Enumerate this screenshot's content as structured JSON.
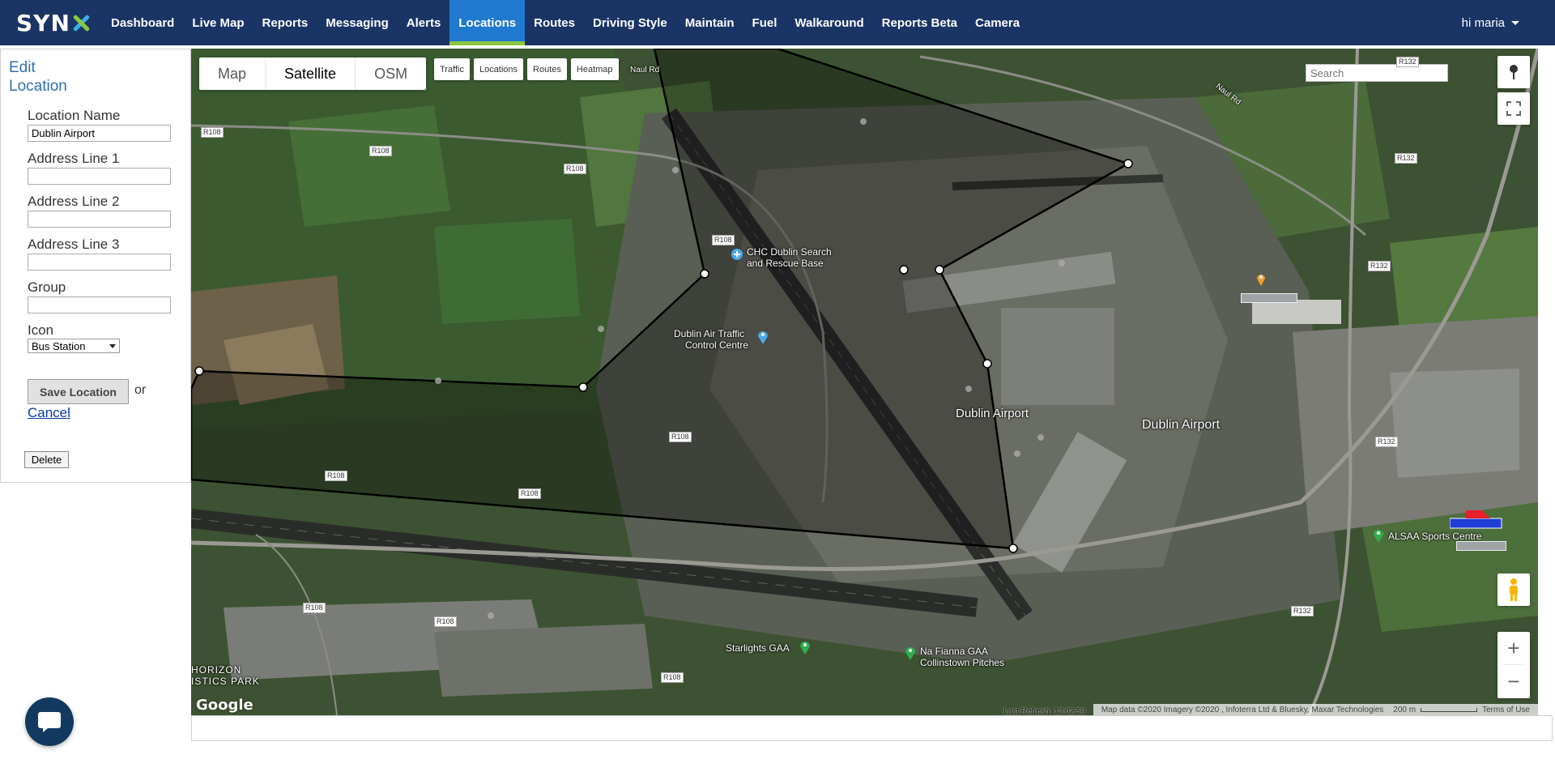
{
  "brand": {
    "logo_text": "SYN"
  },
  "nav": {
    "items": [
      {
        "label": "Dashboard"
      },
      {
        "label": "Live Map"
      },
      {
        "label": "Reports"
      },
      {
        "label": "Messaging"
      },
      {
        "label": "Alerts"
      },
      {
        "label": "Locations"
      },
      {
        "label": "Routes"
      },
      {
        "label": "Driving Style"
      },
      {
        "label": "Maintain"
      },
      {
        "label": "Fuel"
      },
      {
        "label": "Walkaround"
      },
      {
        "label": "Reports Beta"
      },
      {
        "label": "Camera"
      }
    ],
    "active": "Locations",
    "user_greeting": "hi maria"
  },
  "edit_panel": {
    "title_line1": "Edit",
    "title_line2": "Location",
    "location_name_label": "Location Name",
    "location_name_value": "Dublin Airport",
    "address1_label": "Address Line 1",
    "address1_value": "",
    "address2_label": "Address Line 2",
    "address2_value": "",
    "address3_label": "Address Line 3",
    "address3_value": "",
    "group_label": "Group",
    "group_value": "",
    "icon_label": "Icon",
    "icon_value": "Bus Station",
    "save_label": "Save Location",
    "or_text": "or",
    "cancel_label": "Cancel",
    "delete_label": "Delete"
  },
  "map": {
    "map_types": [
      "Map",
      "Satellite",
      "OSM"
    ],
    "active_map_type": "Satellite",
    "layer_buttons": [
      "Traffic",
      "Locations",
      "Routes",
      "Heatmap"
    ],
    "search_placeholder": "Search",
    "zoom_in": "+",
    "zoom_out": "−",
    "google_logo": "Google",
    "last_refresh": "Last Refresh: 13:02:59",
    "attribution": "Map data ©2020 Imagery ©2020 , Infoterra Ltd & Bluesky, Maxar Technologies",
    "scale": "200 m",
    "terms": "Terms of Use",
    "labels": {
      "chc": "CHC Dublin Search and Rescue Base",
      "chc_line1": "CHC Dublin Search",
      "chc_line2": "and Rescue Base",
      "atc_line1": "Dublin Air Traffic",
      "atc_line2": "Control Centre",
      "airport_1": "Dublin Airport",
      "airport_2": "Dublin Airport",
      "alsaa": "ALSAA Sports Centre",
      "starlights": "Starlights GAA",
      "nafianna_line1": "Na Fianna GAA",
      "nafianna_line2": "Collinstown Pitches",
      "horizon_line1": "HORIZON",
      "horizon_line2": "ISTICS PARK",
      "naul_rd_1": "Naul Rd",
      "naul_rd_2": "Naul Rd"
    },
    "road_labels": {
      "r108": "R108",
      "r132": "R132"
    },
    "colors": {
      "polygon_fill": "#000000",
      "polygon_stroke": "#000000",
      "vertex_fill": "#ffffff",
      "vehicle_red": "#e8202a",
      "vehicle_blue": "#1f3fd6"
    }
  },
  "chat": {
    "icon": "chat-bubble-icon"
  }
}
